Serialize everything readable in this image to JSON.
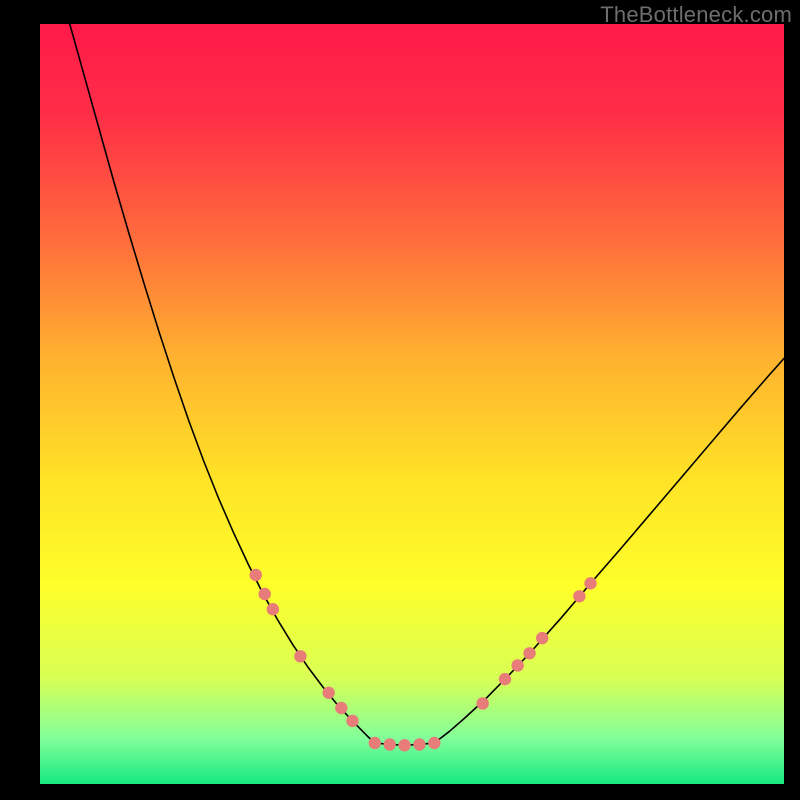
{
  "watermark": "TheBottleneck.com",
  "chart_data": {
    "type": "line",
    "title": "",
    "xlabel": "",
    "ylabel": "",
    "xlim": [
      0,
      100
    ],
    "ylim": [
      0,
      100
    ],
    "grid": false,
    "legend": false,
    "background_gradient": {
      "stops": [
        {
          "offset": 0.0,
          "color": "#ff1a49"
        },
        {
          "offset": 0.12,
          "color": "#ff2e47"
        },
        {
          "offset": 0.28,
          "color": "#ff6b3c"
        },
        {
          "offset": 0.44,
          "color": "#ffb22f"
        },
        {
          "offset": 0.6,
          "color": "#ffe326"
        },
        {
          "offset": 0.74,
          "color": "#fdff2a"
        },
        {
          "offset": 0.86,
          "color": "#d9ff55"
        },
        {
          "offset": 0.94,
          "color": "#82ff9a"
        },
        {
          "offset": 1.0,
          "color": "#17e880"
        }
      ]
    },
    "series": [
      {
        "name": "left-curve",
        "color": "#000000",
        "width": 1.6,
        "x": [
          4,
          6,
          8,
          10,
          12,
          14,
          16,
          18,
          20,
          22,
          24,
          26,
          28,
          30,
          32,
          34,
          36,
          38,
          40,
          42,
          43,
          44,
          45
        ],
        "y": [
          100,
          93,
          86,
          79,
          72.3,
          65.8,
          59.5,
          53.5,
          47.8,
          42.5,
          37.6,
          33.1,
          28.9,
          25.0,
          21.5,
          18.3,
          15.4,
          12.8,
          10.4,
          8.3,
          7.3,
          6.3,
          5.4
        ]
      },
      {
        "name": "flat-bottom",
        "color": "#000000",
        "width": 1.6,
        "x": [
          45,
          47,
          49,
          51,
          53
        ],
        "y": [
          5.4,
          5.2,
          5.1,
          5.2,
          5.4
        ]
      },
      {
        "name": "right-curve",
        "color": "#000000",
        "width": 1.6,
        "x": [
          53,
          55,
          57,
          60,
          63,
          66,
          70,
          74,
          78,
          82,
          86,
          90,
          94,
          98,
          100
        ],
        "y": [
          5.4,
          6.9,
          8.6,
          11.3,
          14.3,
          17.4,
          21.8,
          26.4,
          30.9,
          35.5,
          40.1,
          44.7,
          49.3,
          53.8,
          56.0
        ]
      }
    ],
    "markers": {
      "name": "dots",
      "color": "#e77c78",
      "radius": 6.2,
      "points": [
        {
          "x": 29.0,
          "y": 27.5
        },
        {
          "x": 30.2,
          "y": 25.0
        },
        {
          "x": 31.3,
          "y": 23.0
        },
        {
          "x": 35.0,
          "y": 16.8
        },
        {
          "x": 38.8,
          "y": 12.0
        },
        {
          "x": 40.5,
          "y": 10.0
        },
        {
          "x": 42.0,
          "y": 8.3
        },
        {
          "x": 45.0,
          "y": 5.4
        },
        {
          "x": 47.0,
          "y": 5.2
        },
        {
          "x": 49.0,
          "y": 5.1
        },
        {
          "x": 51.0,
          "y": 5.2
        },
        {
          "x": 53.0,
          "y": 5.4
        },
        {
          "x": 59.5,
          "y": 10.6
        },
        {
          "x": 62.5,
          "y": 13.8
        },
        {
          "x": 64.2,
          "y": 15.6
        },
        {
          "x": 65.8,
          "y": 17.2
        },
        {
          "x": 67.5,
          "y": 19.2
        },
        {
          "x": 72.5,
          "y": 24.7
        },
        {
          "x": 74.0,
          "y": 26.4
        }
      ]
    }
  }
}
